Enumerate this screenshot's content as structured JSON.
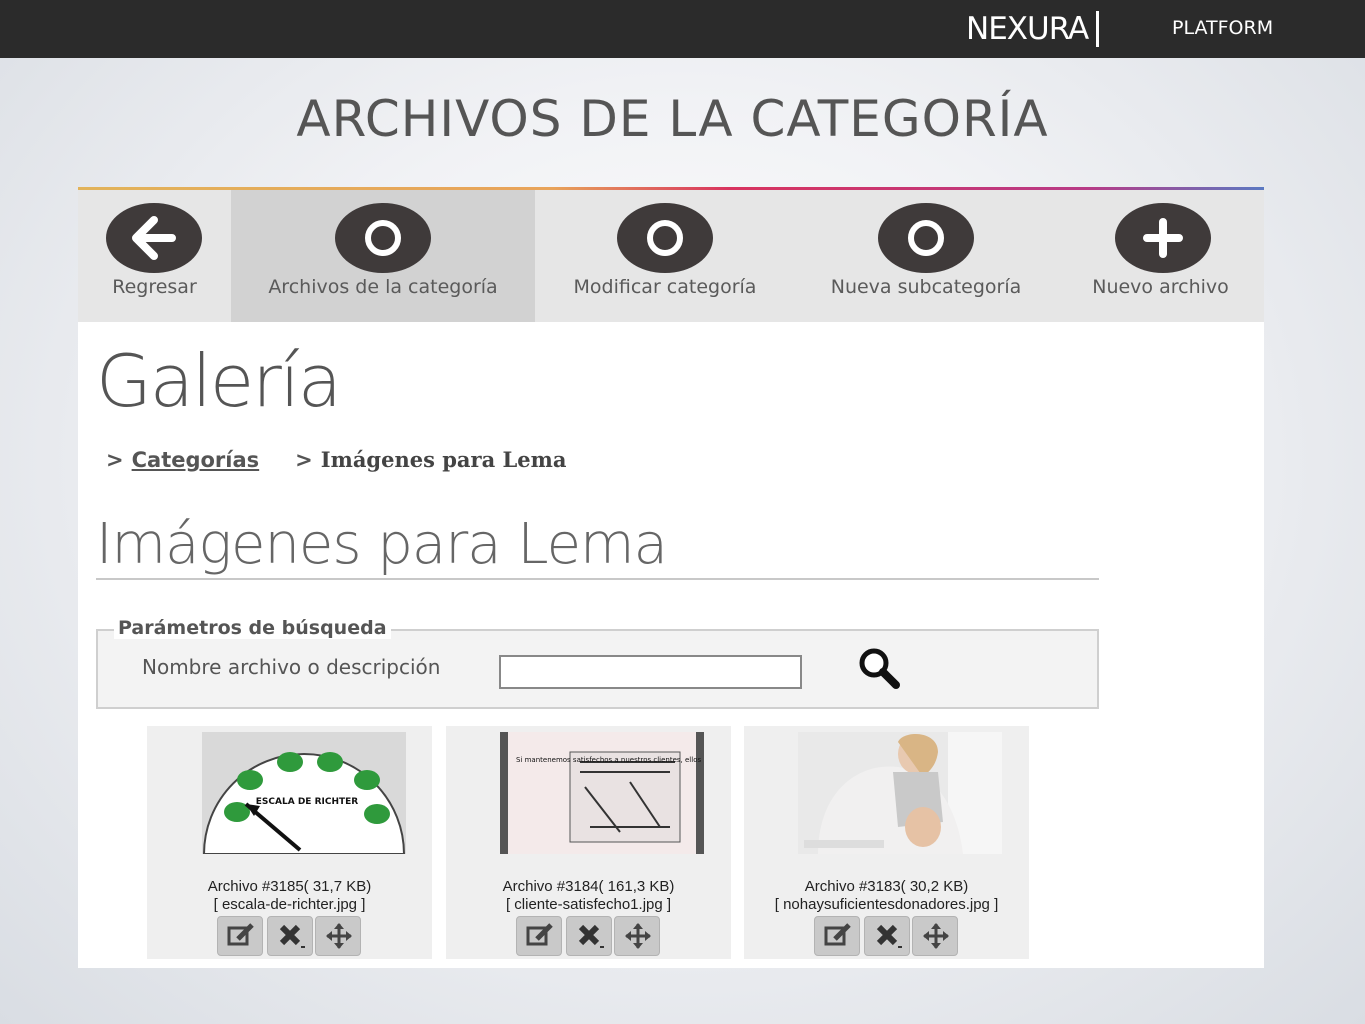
{
  "header": {
    "brand": "NEXURA",
    "platform": "PLATFORM"
  },
  "slide_title": "ARCHIVOS DE LA CATEGORÍA",
  "toolbar": [
    {
      "label": "Regresar",
      "icon": "arrow-left-icon"
    },
    {
      "label": "Archivos de la categoría",
      "icon": "circle-icon",
      "active": true
    },
    {
      "label": "Modificar categoría",
      "icon": "circle-icon"
    },
    {
      "label": "Nueva subcategoría",
      "icon": "circle-icon"
    },
    {
      "label": "Nuevo archivo",
      "icon": "plus-icon"
    }
  ],
  "page": {
    "title": "Galería",
    "breadcrumb": {
      "link": "Categorías",
      "current": "Imágenes para Lema"
    },
    "category_title": "Imágenes para Lema"
  },
  "search": {
    "legend": "Parámetros de búsqueda",
    "label": "Nombre archivo o descripción",
    "value": ""
  },
  "files": [
    {
      "caption": "Archivo #3185( 31,7 KB)",
      "filename": "[ escala-de-richter.jpg ]",
      "thumb_text": "ESCALA DE RICHTER"
    },
    {
      "caption": "Archivo #3184( 161,3 KB)",
      "filename": "[ cliente-satisfecho1.jpg ]",
      "thumb_text": "Si mantenemos satisfechos a nuestros clientes, ellos nos permitirán conservar nuestro trabajo"
    },
    {
      "caption": "Archivo #3183( 30,2 KB)",
      "filename": "[ nohaysuficientesdonadores.jpg ]",
      "thumb_text": ""
    }
  ],
  "file_actions": [
    "edit-icon",
    "delete-icon",
    "move-icon"
  ]
}
